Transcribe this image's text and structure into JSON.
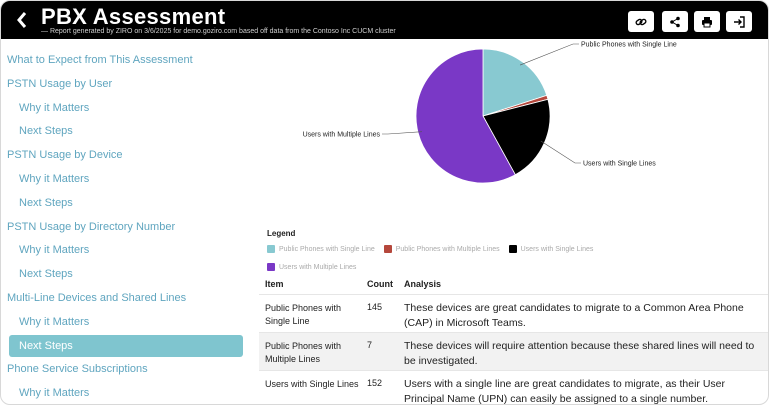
{
  "header": {
    "title": "PBX Assessment",
    "subtitle": "— Report generated by ZIRO on 3/6/2025 for demo.goziro.com based off data from the Contoso Inc CUCM cluster",
    "back_icon": "chevron-left-icon",
    "buttons": [
      {
        "name": "link-button",
        "icon": "link-icon"
      },
      {
        "name": "share-button",
        "icon": "share-icon"
      },
      {
        "name": "print-button",
        "icon": "print-icon"
      },
      {
        "name": "export-button",
        "icon": "sign-in-icon"
      }
    ]
  },
  "sidebar": {
    "items": [
      {
        "label": "What to Expect from This Assessment",
        "level": "top"
      },
      {
        "label": "PSTN Usage by User",
        "level": "top"
      },
      {
        "label": "Why it Matters",
        "level": "sub"
      },
      {
        "label": "Next Steps",
        "level": "sub"
      },
      {
        "label": "PSTN Usage by Device",
        "level": "top"
      },
      {
        "label": "Why it Matters",
        "level": "sub"
      },
      {
        "label": "Next Steps",
        "level": "sub"
      },
      {
        "label": "PSTN Usage by Directory Number",
        "level": "top"
      },
      {
        "label": "Why it Matters",
        "level": "sub"
      },
      {
        "label": "Next Steps",
        "level": "sub"
      },
      {
        "label": "Multi-Line Devices and Shared Lines",
        "level": "top"
      },
      {
        "label": "Why it Matters",
        "level": "sub"
      },
      {
        "label": "Next Steps",
        "level": "sub",
        "active": true
      },
      {
        "label": "Phone Service Subscriptions",
        "level": "top"
      },
      {
        "label": "Why it Matters",
        "level": "sub"
      }
    ]
  },
  "colors": {
    "accent": "#7fc5cf",
    "nav_text": "#5fa5bf",
    "header_bg": "#000000"
  },
  "chart_data": {
    "type": "pie",
    "categories": [
      "Public Phones with Single Line",
      "Public Phones with Multiple Lines",
      "Users with Single Lines",
      "Users with Multiple Lines"
    ],
    "values": [
      145,
      7,
      152,
      420
    ],
    "colors": [
      "#88c9d1",
      "#b5473c",
      "#000000",
      "#7a38c6"
    ],
    "legend_title": "Legend"
  },
  "table": {
    "headers": {
      "item": "Item",
      "count": "Count",
      "analysis": "Analysis"
    },
    "rows": [
      {
        "item": "Public Phones with Single Line",
        "count": "145",
        "analysis": "These devices are great candidates to migrate to a Common Area Phone (CAP) in Microsoft Teams."
      },
      {
        "item": "Public Phones with Multiple Lines",
        "count": "7",
        "analysis": "These devices will require attention because these shared lines will need to be investigated."
      },
      {
        "item": "Users with Single Lines",
        "count": "152",
        "analysis": "Users with a single line are great candidates to migrate, as their User Principal Name (UPN) can easily be assigned to a single number."
      }
    ]
  }
}
